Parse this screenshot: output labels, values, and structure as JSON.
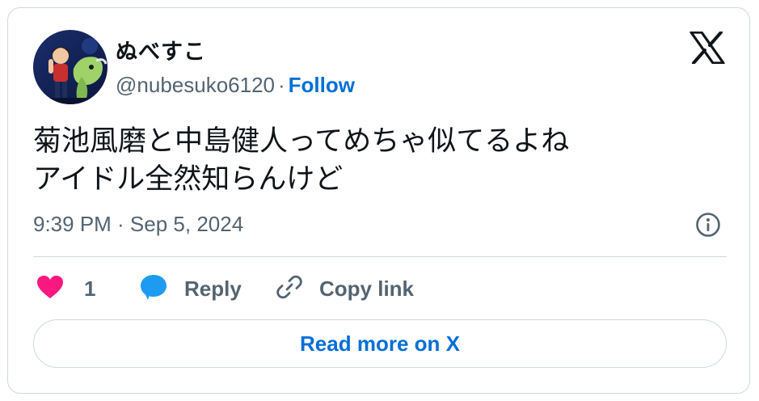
{
  "author": {
    "display_name": "ぬべすこ",
    "handle": "@nubesuko6120",
    "separator": "·",
    "follow_label": "Follow"
  },
  "tweet": {
    "line1": "菊池風磨と中島健人ってめちゃ似てるよね",
    "line2": "アイドル全然知らんけど",
    "timestamp": "9:39 PM · Sep 5, 2024"
  },
  "actions": {
    "like_count": "1",
    "reply_label": "Reply",
    "copy_label": "Copy link"
  },
  "footer": {
    "read_more_label": "Read more on X"
  },
  "icons": {
    "brand": "x-logo-icon",
    "like": "heart-icon",
    "reply": "speech-bubble-icon",
    "copy": "link-icon",
    "info": "info-icon"
  },
  "colors": {
    "like": "#f91880",
    "reply": "#1d9bf0",
    "link": "#006fd6",
    "secondary_text": "#536471",
    "primary_text": "#0f1419",
    "border": "#cfd9de"
  }
}
